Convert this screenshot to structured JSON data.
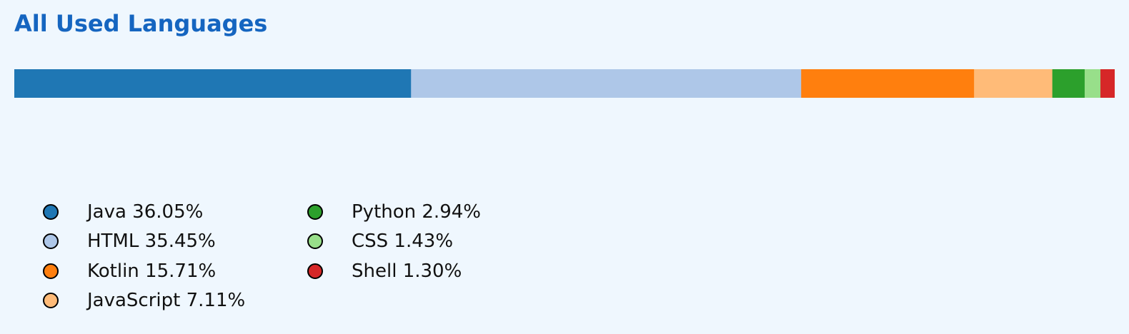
{
  "title": "All Used Languages",
  "colors": {
    "title": "#1565c0",
    "background": "#eff7fe"
  },
  "chart_data": {
    "type": "bar",
    "orientation": "horizontal-stacked",
    "title": "All Used Languages",
    "categories": [
      "Java",
      "HTML",
      "Kotlin",
      "JavaScript",
      "Python",
      "CSS",
      "Shell"
    ],
    "values": [
      36.05,
      35.45,
      15.71,
      7.11,
      2.94,
      1.43,
      1.3
    ],
    "unit": "%",
    "colors": [
      "#1f77b4",
      "#aec7e8",
      "#ff7f0e",
      "#ffbb78",
      "#2ca02c",
      "#98df8a",
      "#d62728"
    ],
    "legend_placement": "bottom-left",
    "grid": false
  },
  "legend": [
    {
      "label": "Java 36.05%"
    },
    {
      "label": "HTML 35.45%"
    },
    {
      "label": "Kotlin 15.71%"
    },
    {
      "label": "JavaScript 7.11%"
    },
    {
      "label": "Python 2.94%"
    },
    {
      "label": "CSS 1.43%"
    },
    {
      "label": "Shell 1.30%"
    }
  ]
}
